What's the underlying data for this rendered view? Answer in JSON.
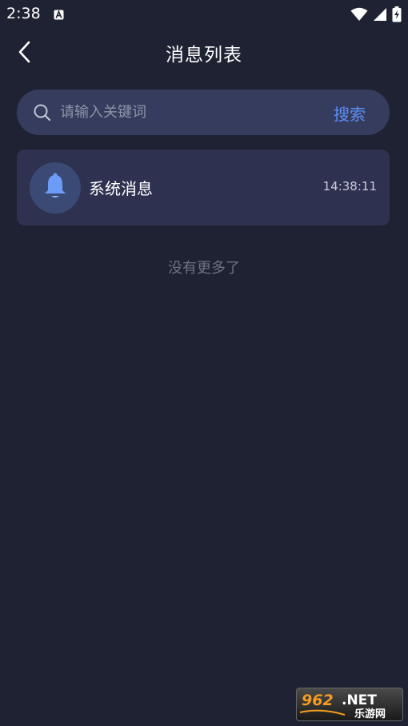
{
  "status_bar": {
    "time": "2:38"
  },
  "header": {
    "title": "消息列表"
  },
  "search": {
    "placeholder": "请输入关键词",
    "button_label": "搜索"
  },
  "messages": [
    {
      "title": "系统消息",
      "time": "14:38:11",
      "icon": "bell-icon"
    }
  ],
  "list_footer": "没有更多了",
  "watermark": {
    "text_top": "962.NET",
    "text_bottom": "乐游网"
  },
  "colors": {
    "background": "#1f2232",
    "search_bg": "#363c5e",
    "card_bg": "#2e3250",
    "accent": "#5b8ff5",
    "bell": "#6a9cf8"
  }
}
